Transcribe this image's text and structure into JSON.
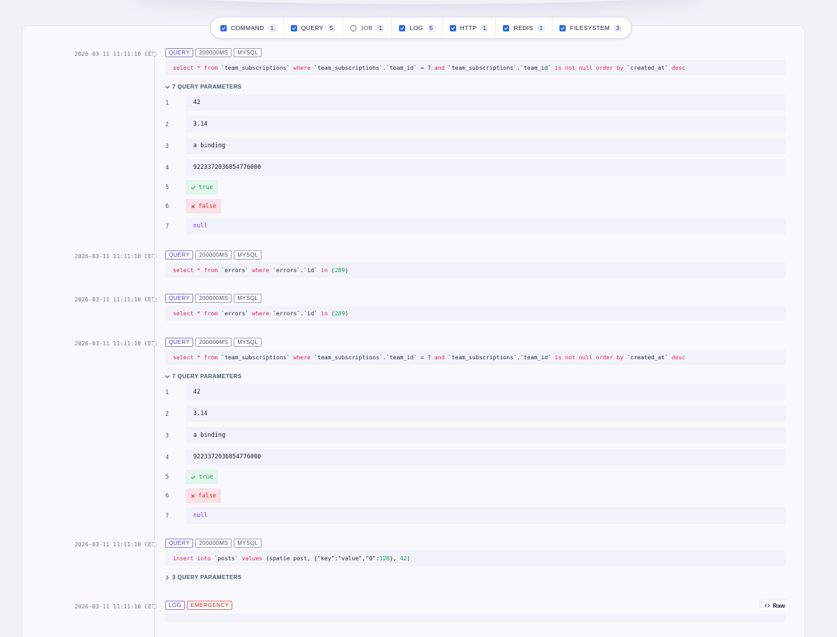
{
  "filters": [
    {
      "label": "COMMAND",
      "count": "1",
      "checked": true
    },
    {
      "label": "QUERY",
      "count": "5",
      "checked": true
    },
    {
      "label": "JOB",
      "count": "1",
      "checked": false
    },
    {
      "label": "LOG",
      "count": "5",
      "checked": true
    },
    {
      "label": "HTTP",
      "count": "1",
      "checked": true
    },
    {
      "label": "REDIS",
      "count": "1",
      "checked": true
    },
    {
      "label": "FILESYSTEM",
      "count": "3",
      "checked": true
    }
  ],
  "entries": [
    {
      "timestamp": "2026-03-11 11:11:10 CET",
      "badges": [
        "QUERY",
        "200000MS",
        "MYSQL"
      ],
      "sql": [
        {
          "t": "select",
          "k": "kw"
        },
        {
          "t": " "
        },
        {
          "t": "*",
          "k": "kw"
        },
        {
          "t": " "
        },
        {
          "t": "from",
          "k": "kw"
        },
        {
          "t": " `team_subscriptions` "
        },
        {
          "t": "where",
          "k": "kw"
        },
        {
          "t": " `team_subscriptions`.`team_id` = ? "
        },
        {
          "t": "and",
          "k": "kw"
        },
        {
          "t": " `team_subscriptions`.`team_id` "
        },
        {
          "t": "is not null order by",
          "k": "kw"
        },
        {
          "t": " `created_at` "
        },
        {
          "t": "desc",
          "k": "kw"
        }
      ],
      "params_label": "7 QUERY PARAMETERS",
      "params_expanded": true,
      "params": [
        {
          "index": "1",
          "value": "42",
          "kind": "text"
        },
        {
          "index": "2",
          "value": "3.14",
          "kind": "text"
        },
        {
          "index": "3",
          "value": "a binding",
          "kind": "text"
        },
        {
          "index": "4",
          "value": "9223372036854776000",
          "kind": "text"
        },
        {
          "index": "5",
          "value": "true",
          "kind": "true"
        },
        {
          "index": "6",
          "value": "false",
          "kind": "false"
        },
        {
          "index": "7",
          "value": "null",
          "kind": "null"
        }
      ]
    },
    {
      "timestamp": "2026-03-11 11:11:10 CET",
      "badges": [
        "QUERY",
        "200000MS",
        "MYSQL"
      ],
      "sql": [
        {
          "t": "select",
          "k": "kw"
        },
        {
          "t": " "
        },
        {
          "t": "*",
          "k": "kw"
        },
        {
          "t": " "
        },
        {
          "t": "from",
          "k": "kw"
        },
        {
          "t": " `errors` "
        },
        {
          "t": "where",
          "k": "kw"
        },
        {
          "t": " `errors`.`id` "
        },
        {
          "t": "in",
          "k": "kw"
        },
        {
          "t": " ("
        },
        {
          "t": "289",
          "k": "num"
        },
        {
          "t": ")"
        }
      ]
    },
    {
      "timestamp": "2026-03-11 11:11:10 CET",
      "badges": [
        "QUERY",
        "200000MS",
        "MYSQL"
      ],
      "sql": [
        {
          "t": "select",
          "k": "kw"
        },
        {
          "t": " "
        },
        {
          "t": "*",
          "k": "kw"
        },
        {
          "t": " "
        },
        {
          "t": "from",
          "k": "kw"
        },
        {
          "t": " `errors` "
        },
        {
          "t": "where",
          "k": "kw"
        },
        {
          "t": " `errors`.`id` "
        },
        {
          "t": "in",
          "k": "kw"
        },
        {
          "t": " ("
        },
        {
          "t": "289",
          "k": "num"
        },
        {
          "t": ")"
        }
      ]
    },
    {
      "timestamp": "2026-03-11 11:11:10 CET",
      "badges": [
        "QUERY",
        "200000MS",
        "MYSQL"
      ],
      "sql": [
        {
          "t": "select",
          "k": "kw"
        },
        {
          "t": " "
        },
        {
          "t": "*",
          "k": "kw"
        },
        {
          "t": " "
        },
        {
          "t": "from",
          "k": "kw"
        },
        {
          "t": " `team_subscriptions` "
        },
        {
          "t": "where",
          "k": "kw"
        },
        {
          "t": " `team_subscriptions`.`team_id` = ? "
        },
        {
          "t": "and",
          "k": "kw"
        },
        {
          "t": " `team_subscriptions`.`team_id` "
        },
        {
          "t": "is not null order by",
          "k": "kw"
        },
        {
          "t": " `created_at` "
        },
        {
          "t": "desc",
          "k": "kw"
        }
      ],
      "params_label": "7 QUERY PARAMETERS",
      "params_expanded": true,
      "params": [
        {
          "index": "1",
          "value": "42",
          "kind": "text"
        },
        {
          "index": "2",
          "value": "3.14",
          "kind": "text"
        },
        {
          "index": "3",
          "value": "a binding",
          "kind": "text"
        },
        {
          "index": "4",
          "value": "9223372036854776000",
          "kind": "text"
        },
        {
          "index": "5",
          "value": "true",
          "kind": "true"
        },
        {
          "index": "6",
          "value": "false",
          "kind": "false"
        },
        {
          "index": "7",
          "value": "null",
          "kind": "null"
        }
      ]
    },
    {
      "timestamp": "2026-03-11 11:11:10 CET",
      "badges": [
        "QUERY",
        "200000MS",
        "MYSQL"
      ],
      "sql": [
        {
          "t": "insert into",
          "k": "kw"
        },
        {
          "t": " `posts` "
        },
        {
          "t": "values",
          "k": "kw"
        },
        {
          "t": " (spatie post, {\"key\":\"value\",\"0\":"
        },
        {
          "t": "128",
          "k": "num"
        },
        {
          "t": "}, "
        },
        {
          "t": "42",
          "k": "num"
        },
        {
          "t": ")"
        }
      ],
      "params_label": "3 QUERY PARAMETERS",
      "params_expanded": false,
      "params": []
    },
    {
      "timestamp": "2026-03-11 11:11:10 CET",
      "badges": [
        "LOG",
        "EMERGENCY"
      ],
      "raw_label": "Raw",
      "sql": []
    }
  ],
  "colors": {
    "accent": "#2563eb",
    "keyword": "#e0245e",
    "number": "#16a34a",
    "true": "#16a34a",
    "false": "#dc2626",
    "null": "#7c3aed"
  }
}
